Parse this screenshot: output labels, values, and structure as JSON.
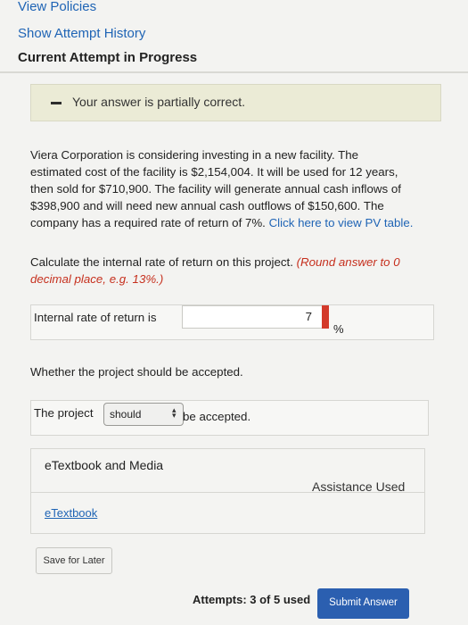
{
  "nav": {
    "view_policies": "View Policies",
    "show_attempt_history": "Show Attempt History",
    "current_attempt": "Current Attempt in Progress"
  },
  "banner": {
    "text": "Your answer is partially correct."
  },
  "problem": {
    "line1": "Viera Corporation is considering investing in a new facility. The",
    "line2": "estimated cost of the facility is $2,154,004. It will be used for 12 years,",
    "line3": "then sold for $710,900. The facility will generate annual cash inflows of",
    "line4": "$398,900 and will need new annual cash outflows of $150,600. The",
    "line5_text": "company has a required rate of return of 7%. ",
    "pv_link": "Click here to view PV table."
  },
  "question1": {
    "text": "Calculate the internal rate of return on this project. ",
    "note_line1": "(Round answer to 0",
    "note_line2": "decimal place, e.g. 13%.)"
  },
  "irr": {
    "label": "Internal rate of return is",
    "value": "7",
    "unit": "%"
  },
  "question2": {
    "text": "Whether the project should be accepted."
  },
  "accept": {
    "prefix": "The project",
    "selected": "should",
    "suffix": "be accepted."
  },
  "etextbook": {
    "title": "eTextbook and Media",
    "assistance": "Assistance Used",
    "link": "eTextbook"
  },
  "buttons": {
    "save_later": "Save for Later",
    "submit": "Submit Answer"
  },
  "attempts": {
    "text": "Attempts: 3 of 5 used"
  },
  "colors": {
    "link": "#1f64b5",
    "note_red": "#c6301e",
    "submit_blue": "#2b5fb0",
    "banner_bg": "#ebebd6",
    "incorrect_marker": "#d33a2b"
  }
}
